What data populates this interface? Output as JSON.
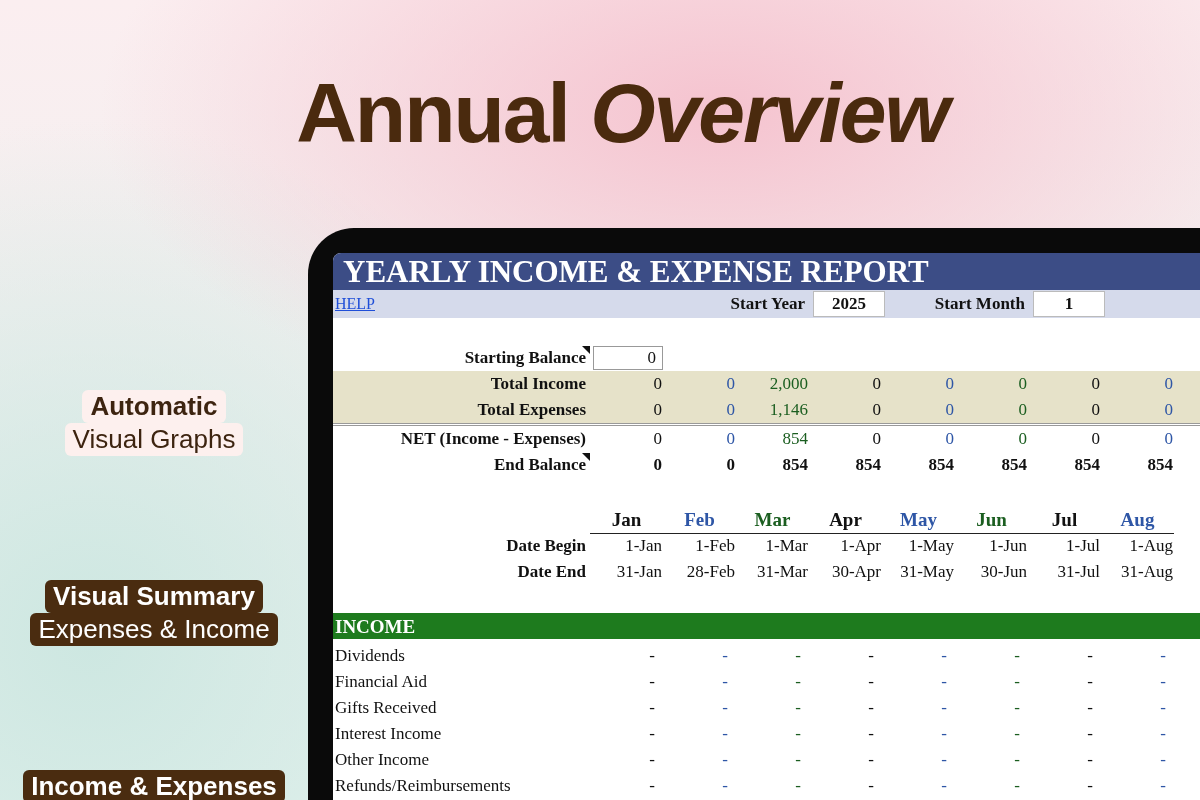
{
  "headline": "Annual *Overview*",
  "callouts": [
    {
      "title": "Automatic",
      "subtitle": "Visual Graphs",
      "kind": "light"
    },
    {
      "title": "Visual Summary",
      "subtitle": "Expenses & Income",
      "kind": "dark"
    },
    {
      "title": "Income & Expenses",
      "kind": "dark"
    }
  ],
  "sheet": {
    "title": "YEARLY INCOME & EXPENSE REPORT",
    "help_link": "HELP",
    "start_year": {
      "label": "Start Year",
      "value": "2025"
    },
    "start_month": {
      "label": "Start Month",
      "value": "1"
    },
    "starting_balance": {
      "label": "Starting Balance",
      "value": "0",
      "has_note": true
    },
    "summary_rows": [
      {
        "label": "Total Income",
        "kind": "shaded",
        "has_note": false,
        "values": [
          "0",
          "0",
          "2,000",
          "0",
          "0",
          "0",
          "0",
          "0"
        ]
      },
      {
        "label": "Total Expenses",
        "kind": "shaded",
        "has_note": false,
        "values": [
          "0",
          "0",
          "1,146",
          "0",
          "0",
          "0",
          "0",
          "0"
        ]
      },
      {
        "label": "NET (Income - Expenses)",
        "kind": "net",
        "has_note": false,
        "values": [
          "0",
          "0",
          "854",
          "0",
          "0",
          "0",
          "0",
          "0"
        ]
      },
      {
        "label": "End Balance",
        "kind": "bold",
        "has_note": true,
        "values": [
          "0",
          "0",
          "854",
          "854",
          "854",
          "854",
          "854",
          "854"
        ]
      }
    ],
    "months": [
      {
        "name": "Jan",
        "color": "#111111"
      },
      {
        "name": "Feb",
        "color": "#2e56a6"
      },
      {
        "name": "Mar",
        "color": "#1b5e20"
      },
      {
        "name": "Apr",
        "color": "#111111"
      },
      {
        "name": "May",
        "color": "#2e56a6"
      },
      {
        "name": "Jun",
        "color": "#1b5e20"
      },
      {
        "name": "Jul",
        "color": "#111111"
      },
      {
        "name": "Aug",
        "color": "#2e56a6"
      }
    ],
    "date_rows": [
      {
        "label": "Date Begin",
        "values": [
          "1-Jan",
          "1-Feb",
          "1-Mar",
          "1-Apr",
          "1-May",
          "1-Jun",
          "1-Jul",
          "1-Aug"
        ]
      },
      {
        "label": "Date End",
        "values": [
          "31-Jan",
          "28-Feb",
          "31-Mar",
          "30-Apr",
          "31-May",
          "30-Jun",
          "31-Jul",
          "31-Aug"
        ]
      }
    ],
    "section": {
      "title": "INCOME",
      "rows": [
        {
          "label": "Dividends",
          "values": [
            "-",
            "-",
            "-",
            "-",
            "-",
            "-",
            "-",
            "-"
          ]
        },
        {
          "label": "Financial Aid",
          "values": [
            "-",
            "-",
            "-",
            "-",
            "-",
            "-",
            "-",
            "-"
          ]
        },
        {
          "label": "Gifts Received",
          "values": [
            "-",
            "-",
            "-",
            "-",
            "-",
            "-",
            "-",
            "-"
          ]
        },
        {
          "label": "Interest Income",
          "values": [
            "-",
            "-",
            "-",
            "-",
            "-",
            "-",
            "-",
            "-"
          ]
        },
        {
          "label": "Other Income",
          "values": [
            "-",
            "-",
            "-",
            "-",
            "-",
            "-",
            "-",
            "-"
          ]
        },
        {
          "label": "Refunds/Reimbursements",
          "values": [
            "-",
            "-",
            "-",
            "-",
            "-",
            "-",
            "-",
            "-"
          ]
        }
      ]
    }
  }
}
